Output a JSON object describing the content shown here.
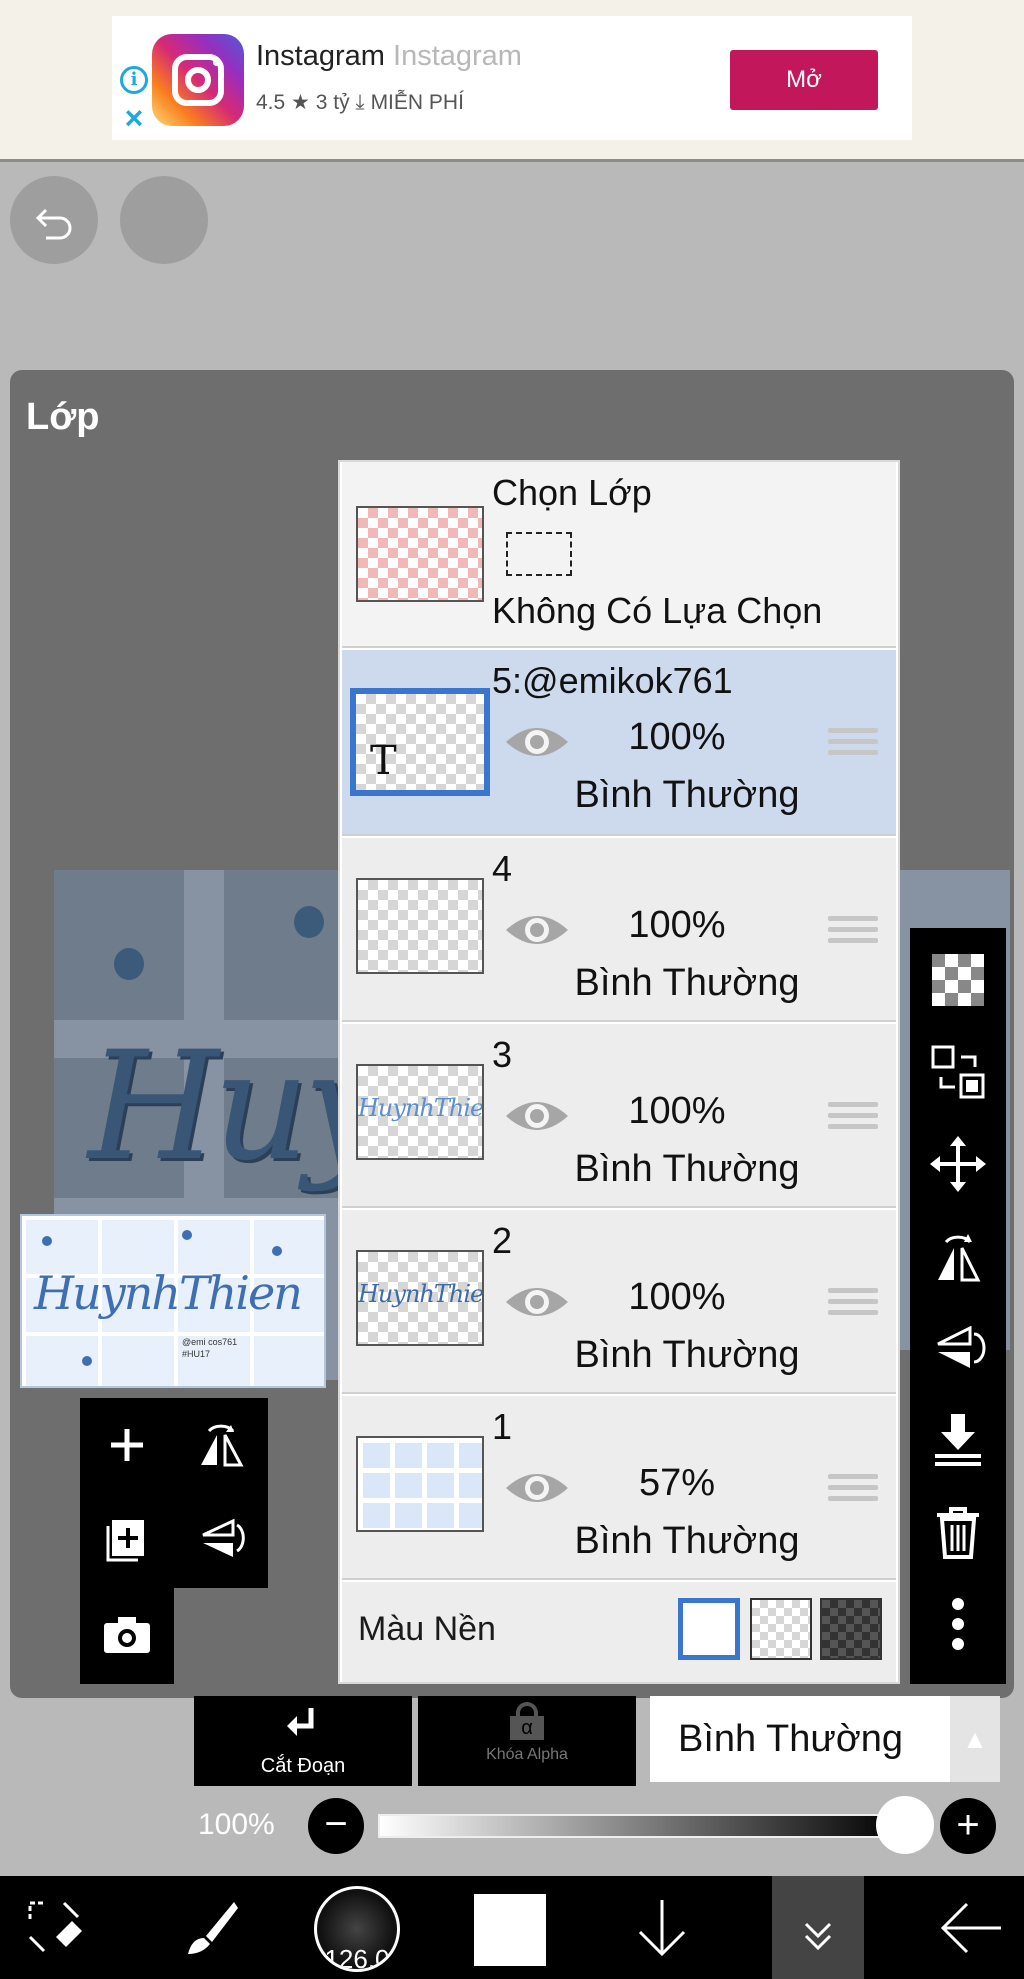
{
  "ad": {
    "app_name": "Instagram",
    "app_name_ghost": "Instagram",
    "rating": "4.5",
    "star": "★",
    "downloads": "3 tỷ",
    "download_icon": "download-icon",
    "price": "MIỄN PHÍ",
    "cta": "Mở",
    "info_glyph": "i",
    "close_glyph": "×"
  },
  "panel": {
    "title": "Lớp"
  },
  "selection_layer": {
    "title": "Chọn Lớp",
    "status": "Không Có Lựa Chọn"
  },
  "layers": [
    {
      "name": "5:@emikok761",
      "opacity": "100%",
      "blend": "Bình Thường",
      "thumb_letter": "T",
      "selected": true
    },
    {
      "name": "4",
      "opacity": "100%",
      "blend": "Bình Thường",
      "selected": false
    },
    {
      "name": "3",
      "opacity": "100%",
      "blend": "Bình Thường",
      "thumb_text": "HuynhThien",
      "selected": false
    },
    {
      "name": "2",
      "opacity": "100%",
      "blend": "Bình Thường",
      "thumb_text": "HuynhThien",
      "selected": false
    },
    {
      "name": "1",
      "opacity": "57%",
      "blend": "Bình Thường",
      "selected": false
    }
  ],
  "background_color": {
    "label": "Màu Nền"
  },
  "artwork": {
    "big_text": "Huyn",
    "ref_text": "HuynhThien",
    "ref_small": "@emi cos761\n#HU17"
  },
  "bottom": {
    "clip_label": "Cắt Đoạn",
    "alpha_label": "Khóa Alpha",
    "alpha_glyph": "α",
    "blend_mode": "Bình Thường",
    "opacity_label": "100%",
    "opacity_value": 1.0,
    "brush_size": "126.0"
  },
  "colors": {
    "accent": "#3a76cc",
    "ad_button": "#c2185b",
    "selected_row": "#cdd9ec"
  }
}
